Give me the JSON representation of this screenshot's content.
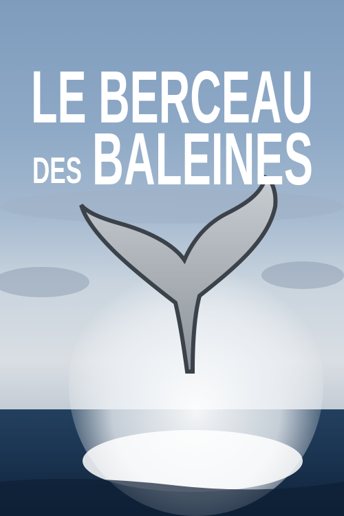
{
  "poster": {
    "title_line1": "LE BERCEAU",
    "title_line2_small": "DES",
    "title_line2_large": "BALEINES"
  }
}
